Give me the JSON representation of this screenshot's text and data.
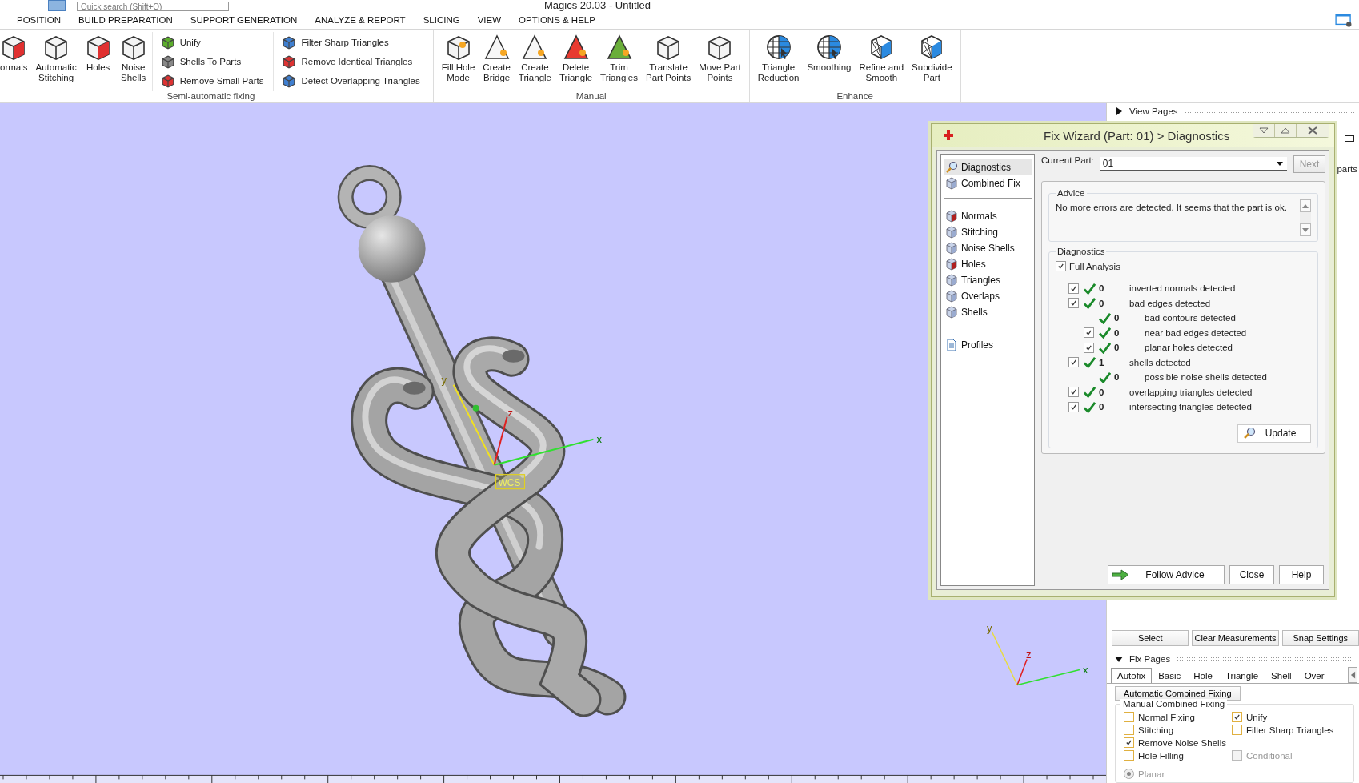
{
  "window": {
    "title": "Magics 20.03 - Untitled"
  },
  "quick_search": {
    "placeholder": "Quick search (Shift+Q)"
  },
  "menu_tabs": [
    "POSITION",
    "BUILD PREPARATION",
    "SUPPORT GENERATION",
    "ANALYZE & REPORT",
    "SLICING",
    "VIEW",
    "OPTIONS & HELP"
  ],
  "ribbon_groups": [
    {
      "label": "Semi-automatic fixing",
      "items": [
        {
          "kind": "large",
          "label": "ormals"
        },
        {
          "kind": "large",
          "label": "Automatic\nStitching"
        },
        {
          "kind": "large",
          "label": "Holes"
        },
        {
          "kind": "large",
          "label": "Noise\nShells"
        },
        {
          "kind": "stack",
          "items": [
            "Unify",
            "Shells To Parts",
            "Remove Small Parts"
          ]
        },
        {
          "kind": "stack",
          "items": [
            "Filter Sharp Triangles",
            "Remove Identical Triangles",
            "Detect Overlapping Triangles"
          ]
        }
      ]
    },
    {
      "label": "Manual",
      "items": [
        {
          "kind": "large",
          "label": "Fill Hole\nMode"
        },
        {
          "kind": "large",
          "label": "Create\nBridge"
        },
        {
          "kind": "large",
          "label": "Create\nTriangle"
        },
        {
          "kind": "large",
          "label": "Delete\nTriangle"
        },
        {
          "kind": "large",
          "label": "Trim\nTriangles"
        },
        {
          "kind": "large",
          "label": "Translate\nPart Points"
        },
        {
          "kind": "large",
          "label": "Move Part\nPoints"
        }
      ]
    },
    {
      "label": "Enhance",
      "items": [
        {
          "kind": "large",
          "label": "Triangle\nReduction"
        },
        {
          "kind": "large",
          "label": "Smoothing"
        },
        {
          "kind": "large",
          "label": "Refine and\nSmooth"
        },
        {
          "kind": "large",
          "label": "Subdivide\nPart"
        }
      ]
    }
  ],
  "viewport": {
    "axis_labels": [
      "y",
      "z",
      "x"
    ],
    "origin_label": "WCS",
    "mini_axis_labels": [
      "y",
      "z",
      "x"
    ]
  },
  "fix_wizard": {
    "title": "Fix Wizard (Part: 01) > Diagnostics",
    "nav_sections": [
      [
        {
          "label": "Diagnostics",
          "selected": true
        },
        {
          "label": "Combined Fix",
          "selected": false
        }
      ],
      [
        {
          "label": "Normals",
          "selected": false
        },
        {
          "label": "Stitching",
          "selected": false
        },
        {
          "label": "Noise Shells",
          "selected": false
        },
        {
          "label": "Holes",
          "selected": false
        },
        {
          "label": "Triangles",
          "selected": false
        },
        {
          "label": "Overlaps",
          "selected": false
        },
        {
          "label": "Shells",
          "selected": false
        }
      ],
      [
        {
          "label": "Profiles",
          "selected": false
        }
      ]
    ],
    "current_part": {
      "label": "Current Part:",
      "value": "01"
    },
    "next_button": {
      "label": "Next",
      "disabled": true
    },
    "advice": {
      "title": "Advice",
      "text": "No more errors are detected. It seems that the part is ok."
    },
    "diagnostics": {
      "title": "Diagnostics",
      "full_analysis": {
        "label": "Full Analysis",
        "checked": true
      },
      "rows": [
        {
          "kind": "checkable",
          "checked": true,
          "ok": true,
          "count": "0",
          "label": "inverted normals detected"
        },
        {
          "kind": "checkable",
          "checked": true,
          "ok": true,
          "count": "0",
          "label": "bad edges detected",
          "children": [
            {
              "kind": "plain",
              "ok": true,
              "count": "0",
              "label": "bad contours detected"
            },
            {
              "kind": "checkable",
              "checked": true,
              "ok": true,
              "count": "0",
              "label": "near bad edges detected"
            },
            {
              "kind": "checkable",
              "checked": true,
              "ok": true,
              "count": "0",
              "label": "planar holes detected"
            }
          ]
        },
        {
          "kind": "checkable",
          "checked": true,
          "ok": true,
          "count": "1",
          "label": "shells detected",
          "children": [
            {
              "kind": "plain",
              "ok": true,
              "count": "0",
              "label": "possible noise shells detected"
            }
          ]
        },
        {
          "kind": "checkable",
          "checked": true,
          "ok": true,
          "count": "0",
          "label": "overlapping triangles detected"
        },
        {
          "kind": "checkable",
          "checked": true,
          "ok": true,
          "count": "0",
          "label": "intersecting triangles detected"
        }
      ],
      "update_button": "Update"
    },
    "buttons": [
      {
        "kind": "follow",
        "label": "Follow Advice"
      },
      {
        "kind": "plain",
        "label": "Close"
      },
      {
        "kind": "plain",
        "label": "Help"
      }
    ]
  },
  "right_panel": {
    "view_pages": {
      "title": "View Pages",
      "expanded": false
    },
    "partial_tab_label": "parts",
    "measure_buttons": [
      "Select",
      "Clear Measurements",
      "Snap Settings"
    ],
    "fix_pages": {
      "title": "Fix Pages",
      "expanded": true,
      "tabs": [
        {
          "label": "Autofix",
          "selected": true
        },
        {
          "label": "Basic",
          "selected": false
        },
        {
          "label": "Hole",
          "selected": false
        },
        {
          "label": "Triangle",
          "selected": false
        },
        {
          "label": "Shell",
          "selected": false
        },
        {
          "label": "Over",
          "selected": false
        }
      ],
      "auto_button": "Automatic Combined Fixing",
      "group_title": "Manual Combined Fixing",
      "option_rows": [
        [
          {
            "label": "Normal Fixing",
            "checked": false,
            "disabled": false
          },
          {
            "label": "Unify",
            "checked": true,
            "disabled": false
          }
        ],
        [
          {
            "label": "Stitching",
            "checked": false,
            "disabled": false
          },
          {
            "label": "Filter Sharp Triangles",
            "checked": false,
            "disabled": false
          }
        ],
        [
          {
            "label": "Remove Noise Shells",
            "checked": true,
            "disabled": false
          }
        ],
        [
          {
            "label": "Hole Filling",
            "checked": false,
            "disabled": false
          },
          {
            "label": "Conditional",
            "checked": false,
            "disabled": true
          }
        ]
      ],
      "radios": [
        {
          "label": "Planar",
          "selected": true,
          "disabled": true
        }
      ]
    }
  }
}
